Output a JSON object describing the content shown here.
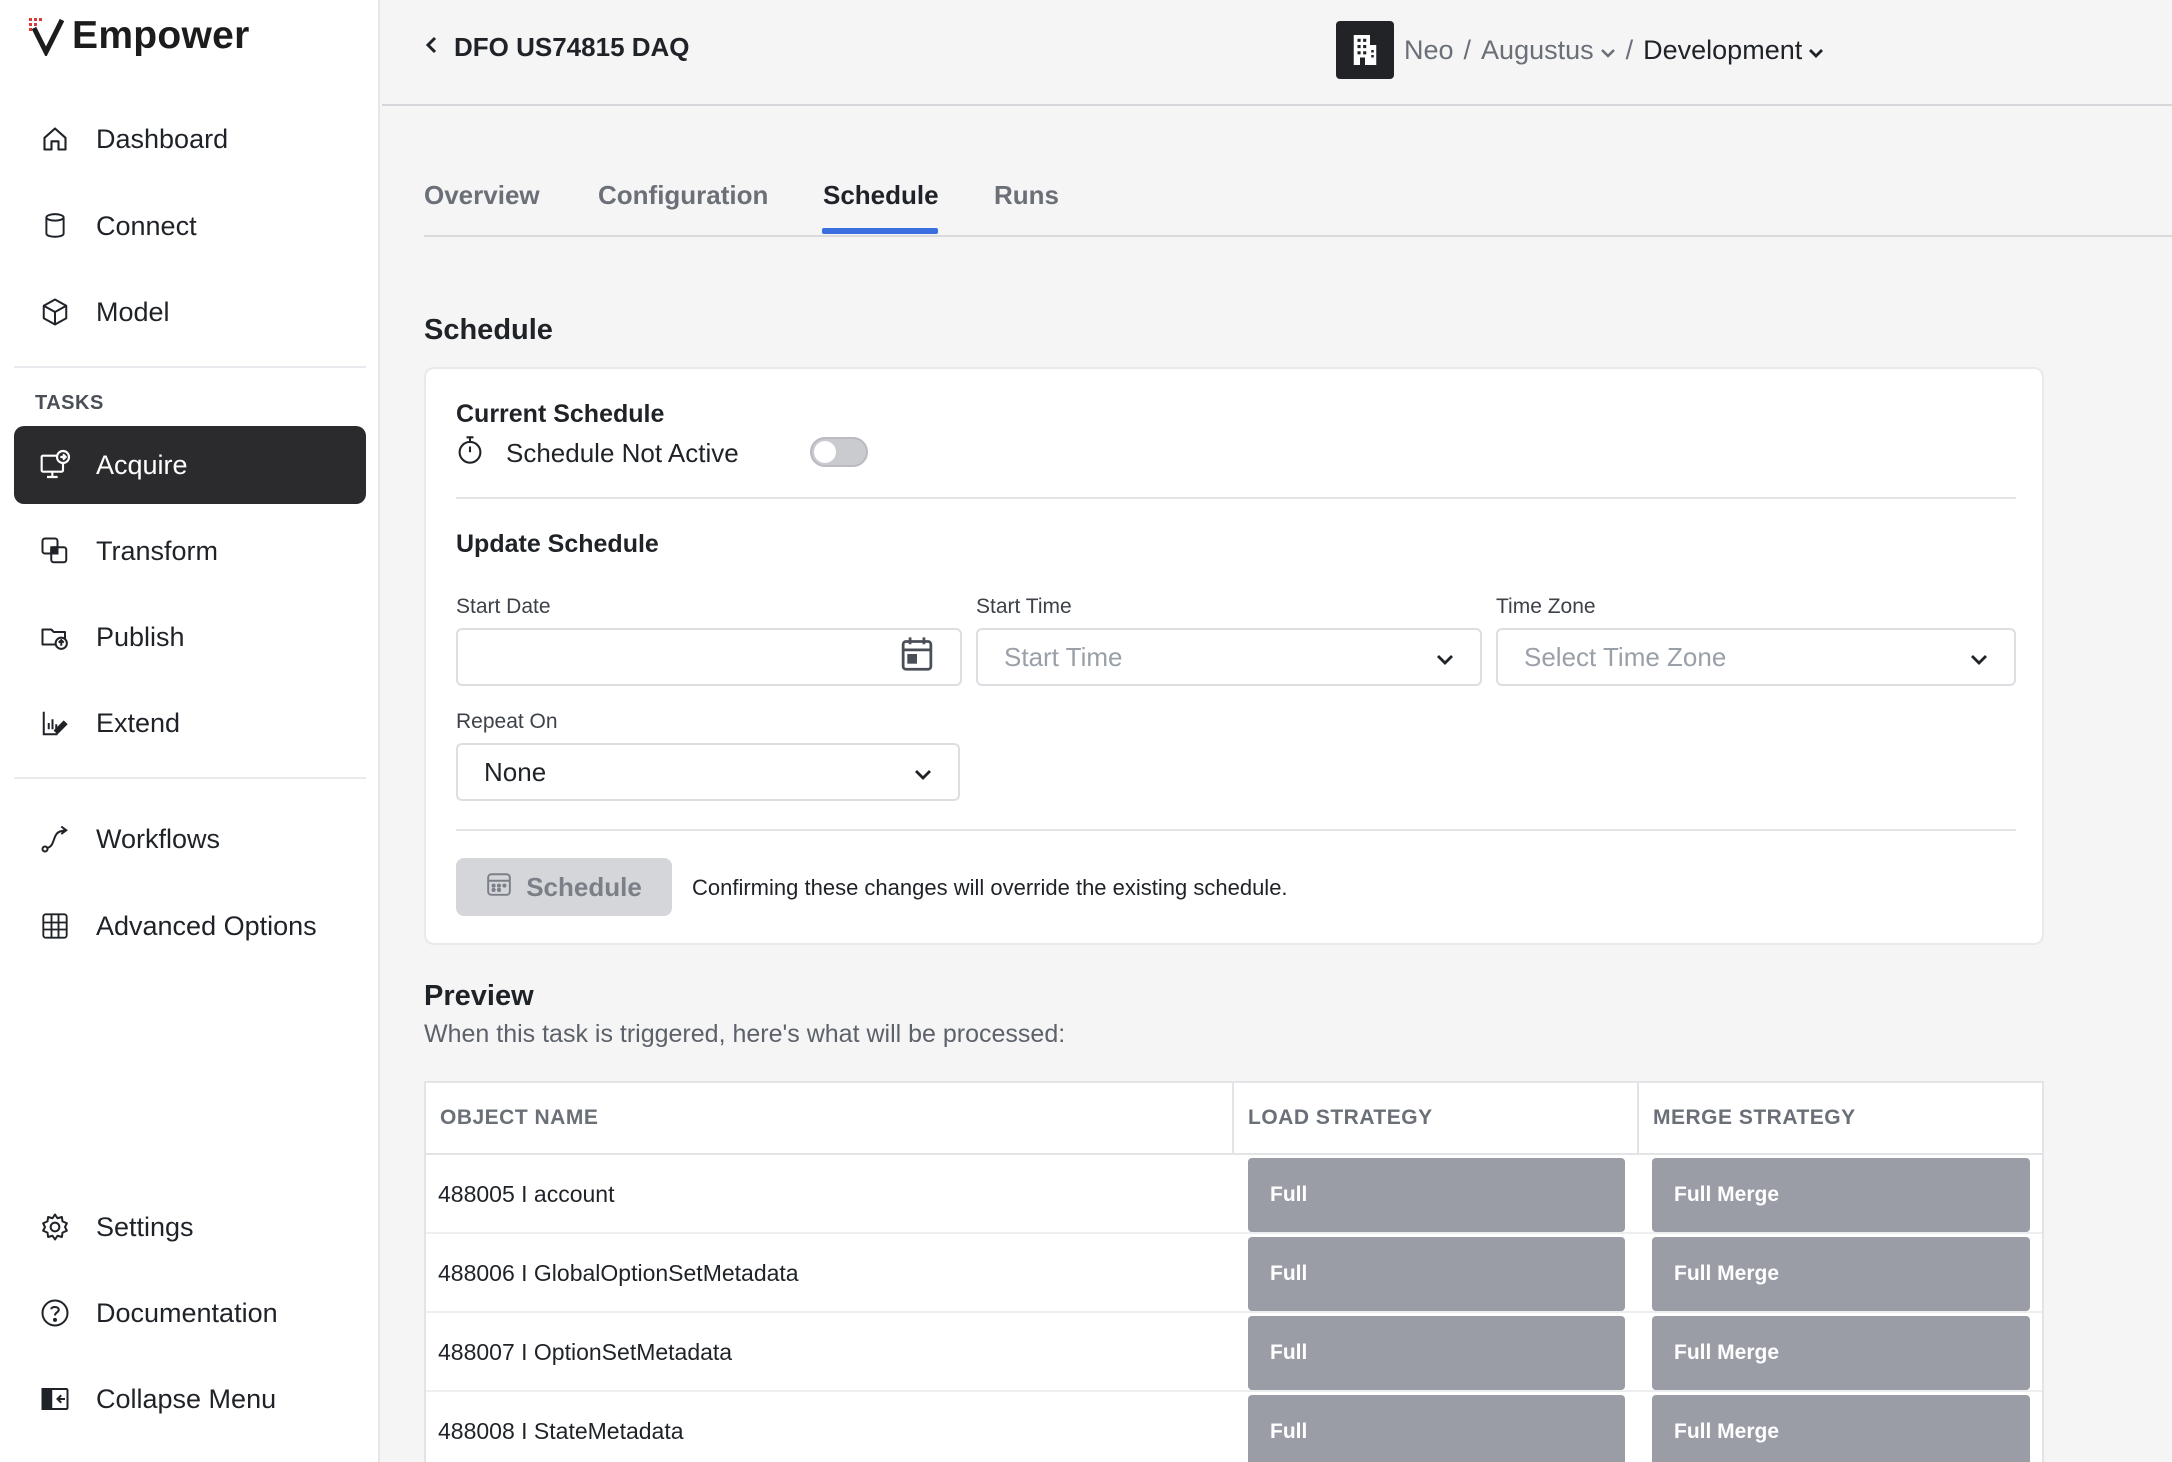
{
  "app": {
    "name": "Empower",
    "brand_color": "#2b2b2d",
    "accent_color": "#3b6fe0"
  },
  "sidebar": {
    "main_items": [
      {
        "label": "Dashboard",
        "icon": "home-icon"
      },
      {
        "label": "Connect",
        "icon": "database-icon"
      },
      {
        "label": "Model",
        "icon": "cube-icon"
      }
    ],
    "tasks_heading": "TASKS",
    "task_items": [
      {
        "label": "Acquire",
        "icon": "acquire-icon",
        "active": true
      },
      {
        "label": "Transform",
        "icon": "transform-icon"
      },
      {
        "label": "Publish",
        "icon": "publish-icon"
      },
      {
        "label": "Extend",
        "icon": "extend-icon"
      }
    ],
    "other_items": [
      {
        "label": "Workflows",
        "icon": "workflow-icon"
      },
      {
        "label": "Advanced Options",
        "icon": "grid-icon"
      }
    ],
    "bottom_items": [
      {
        "label": "Settings",
        "icon": "gear-icon"
      },
      {
        "label": "Documentation",
        "icon": "help-icon"
      },
      {
        "label": "Collapse Menu",
        "icon": "collapse-icon"
      }
    ]
  },
  "header": {
    "back_label": "DFO US74815 DAQ",
    "breadcrumb": {
      "org": "Neo",
      "separator": "/",
      "project": "Augustus",
      "environment": "Development"
    }
  },
  "tabs": [
    {
      "label": "Overview"
    },
    {
      "label": "Configuration"
    },
    {
      "label": "Schedule",
      "active": true
    },
    {
      "label": "Runs"
    }
  ],
  "schedule": {
    "section_title": "Schedule",
    "current_heading": "Current Schedule",
    "status_text": "Schedule Not Active",
    "active": false,
    "update_heading": "Update Schedule",
    "start_date": {
      "label": "Start Date",
      "value": ""
    },
    "start_time": {
      "label": "Start Time",
      "placeholder": "Start Time"
    },
    "time_zone": {
      "label": "Time Zone",
      "placeholder": "Select Time Zone"
    },
    "repeat_on": {
      "label": "Repeat On",
      "value": "None"
    },
    "button_label": "Schedule",
    "confirm_note": "Confirming these changes will override the existing schedule."
  },
  "preview": {
    "title": "Preview",
    "subtitle": "When this task is triggered, here's what will be processed:",
    "columns": [
      "OBJECT NAME",
      "LOAD STRATEGY",
      "MERGE STRATEGY"
    ],
    "rows": [
      {
        "name": "488005 I account",
        "load": "Full",
        "merge": "Full Merge"
      },
      {
        "name": "488006 I GlobalOptionSetMetadata",
        "load": "Full",
        "merge": "Full Merge"
      },
      {
        "name": "488007 I OptionSetMetadata",
        "load": "Full",
        "merge": "Full Merge"
      },
      {
        "name": "488008 I StateMetadata",
        "load": "Full",
        "merge": "Full Merge"
      }
    ]
  }
}
